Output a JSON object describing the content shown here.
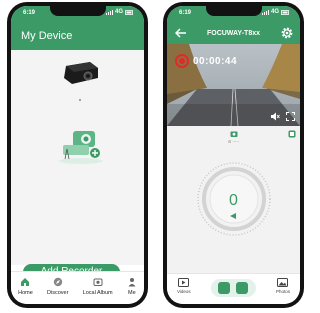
{
  "left": {
    "status": {
      "time": "6:19",
      "network": "4G"
    },
    "header": {
      "title": "My Device"
    },
    "add_button": {
      "label": "Add Recorder"
    },
    "nav": [
      {
        "label": "Home",
        "icon": "home-icon"
      },
      {
        "label": "Discover",
        "icon": "compass-icon"
      },
      {
        "label": "Local Album",
        "icon": "album-icon"
      },
      {
        "label": "Me",
        "icon": "person-icon"
      }
    ]
  },
  "right": {
    "status": {
      "time": "6:19",
      "network": "4G"
    },
    "header": {
      "title": "FOCUWAY-T8xx"
    },
    "recording": {
      "time": "00:00:44"
    },
    "speed": {
      "value": "0"
    },
    "bottom": {
      "videos_label": "Videos",
      "photos_label": "Photos"
    }
  },
  "colors": {
    "accent": "#3c9a66",
    "record": "#e02a2a"
  }
}
